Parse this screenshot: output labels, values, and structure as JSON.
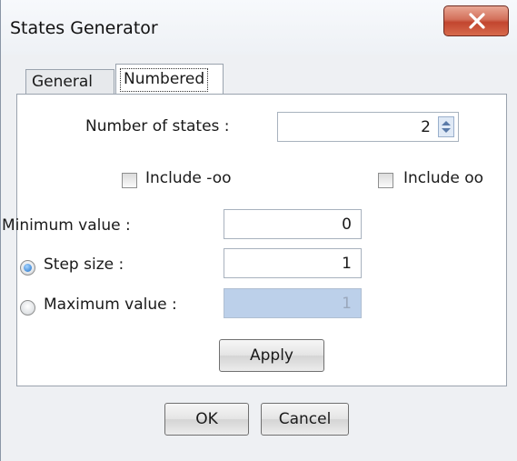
{
  "window": {
    "title": "States Generator"
  },
  "tabs": [
    {
      "label": "General",
      "active": false
    },
    {
      "label": "Numbered",
      "active": true
    }
  ],
  "numbered": {
    "num_states_label": "Number of states :",
    "num_states_value": "2",
    "include_neg_inf_label": "Include -oo",
    "include_neg_inf_checked": false,
    "include_pos_inf_label": "Include oo",
    "include_pos_inf_checked": false,
    "min_label": "Minimum value :",
    "min_value": "0",
    "step_label": "Step size :",
    "step_selected": true,
    "step_value": "1",
    "max_label": "Maximum value :",
    "max_selected": false,
    "max_value": "1",
    "apply_label": "Apply"
  },
  "footer": {
    "ok_label": "OK",
    "cancel_label": "Cancel"
  },
  "icons": {
    "close": "close-icon",
    "spinner": "spinner-icon"
  },
  "colors": {
    "close_button": "#c7472f",
    "disabled_field": "#bcd0ea",
    "radio_selected": "#1f6fc8"
  }
}
